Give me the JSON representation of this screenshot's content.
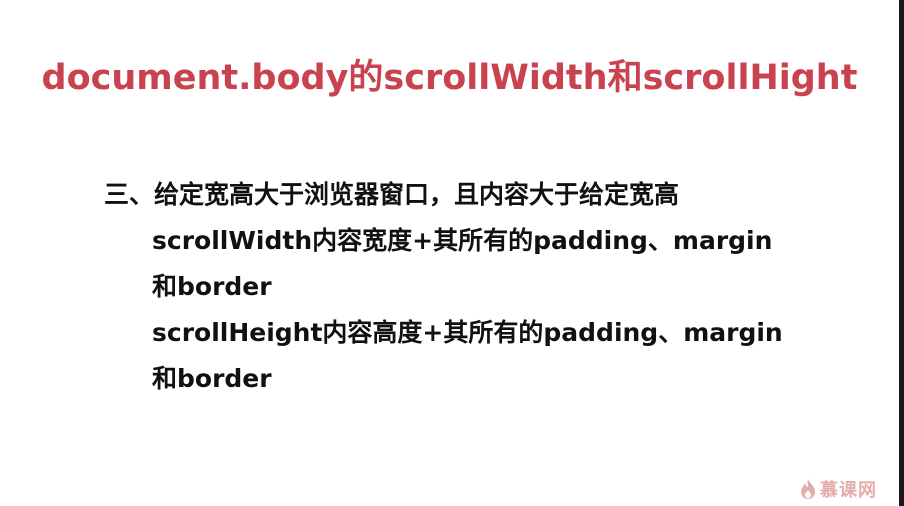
{
  "slide": {
    "title": "document.body的scrollWidth和scrollHight",
    "lines": [
      "三、给定宽高大于浏览器窗口，且内容大于给定宽高",
      "scrollWidth内容宽度+其所有的padding、margin",
      "和border",
      "scrollHeight内容高度+其所有的padding、margin",
      "和border"
    ]
  },
  "watermark": {
    "icon": "flame-icon",
    "text": "慕课网"
  },
  "colors": {
    "title": "#c9424f",
    "body": "#111111",
    "background": "#ffffff",
    "watermark": "#d06a6a"
  }
}
